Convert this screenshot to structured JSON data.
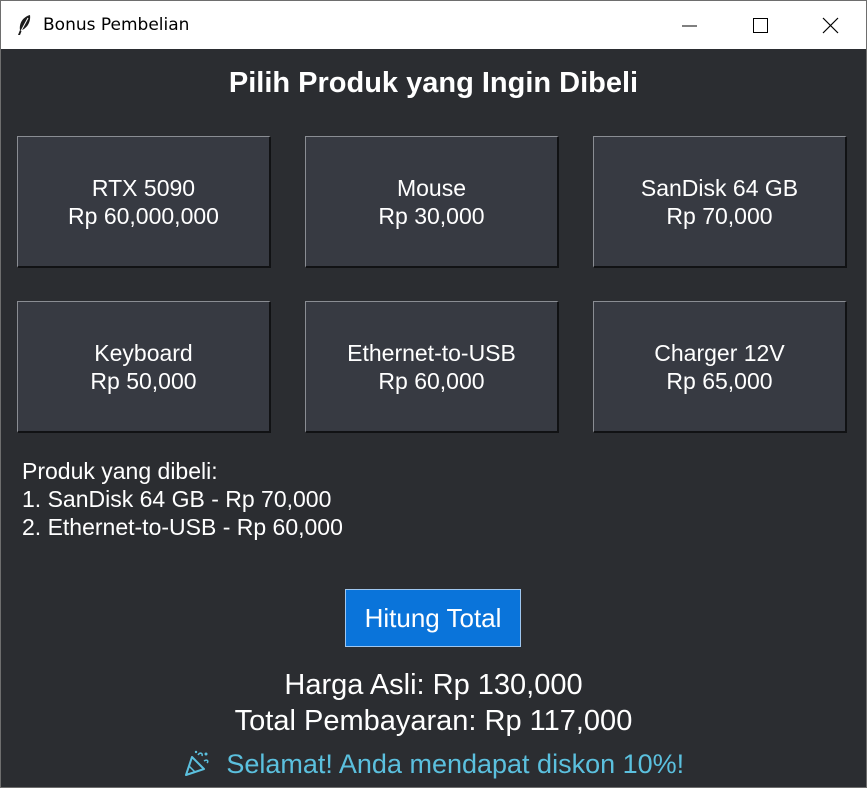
{
  "window": {
    "title": "Bonus Pembelian"
  },
  "heading": "Pilih Produk yang Ingin Dibeli",
  "products": [
    {
      "name": "RTX 5090",
      "price": "Rp 60,000,000"
    },
    {
      "name": "Mouse",
      "price": "Rp 30,000"
    },
    {
      "name": "SanDisk 64 GB",
      "price": "Rp 70,000"
    },
    {
      "name": "Keyboard",
      "price": "Rp 50,000"
    },
    {
      "name": "Ethernet-to-USB",
      "price": "Rp 60,000"
    },
    {
      "name": "Charger 12V",
      "price": "Rp 65,000"
    }
  ],
  "purchased": {
    "label": "Produk yang dibeli:",
    "items": [
      "1. SanDisk 64 GB - Rp 70,000",
      "2. Ethernet-to-USB - Rp 60,000"
    ]
  },
  "calculate_button": "Hitung Total",
  "result": {
    "original_price": "Harga Asli: Rp 130,000",
    "total_payment": "Total Pembayaran: Rp 117,000",
    "congrats": "Selamat! Anda mendapat diskon 10%!"
  },
  "icons": {
    "app": "feather-icon",
    "minimize": "minimize-icon",
    "maximize": "maximize-icon",
    "close": "close-icon",
    "congrats": "party-popper-icon"
  },
  "colors": {
    "background": "#2b2d31",
    "product_button": "#373a42",
    "accent_button": "#0a74da",
    "congrats_text": "#5bc0de"
  }
}
